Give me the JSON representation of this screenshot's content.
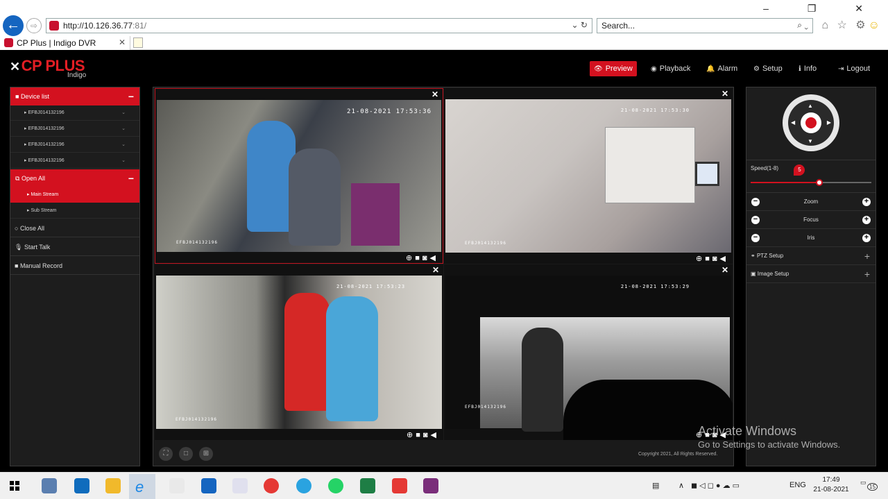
{
  "browser": {
    "url_host": "http://10.126.36.77",
    "url_port": ":81/",
    "url_ctrls": "⌄ ↻",
    "search_placeholder": "Search...",
    "search_icon": "⌕ ⌄",
    "tab_title": "CP Plus | Indigo DVR",
    "tab_close": "✕",
    "window_controls": "– ❐ ✕",
    "toolbar_icons": "⌂ ☆ ⚙"
  },
  "app": {
    "logo": "CP PLUS",
    "logo_sub": "Indigo",
    "nav": [
      {
        "icon": "👁",
        "label": "Preview"
      },
      {
        "icon": "◉",
        "label": "Playback"
      },
      {
        "icon": "🔔",
        "label": "Alarm"
      },
      {
        "icon": "⚙",
        "label": "Setup"
      },
      {
        "icon": "ℹ",
        "label": "Info"
      },
      {
        "icon": "⇥",
        "label": "Logout"
      }
    ]
  },
  "left_panel": {
    "device_list_label": "Device list",
    "devices": [
      "EFBJ014132196",
      "EFBJ014132196",
      "EFBJ014132196",
      "EFBJ014132196"
    ],
    "open_all_label": "Open All",
    "main_stream": "Main Stream",
    "sub_stream": "Sub Stream",
    "close_all": "Close All",
    "start_talk": "Start Talk",
    "manual_record": "Manual Record"
  },
  "feeds": [
    {
      "timestamp": "21-08-2021 17:53:36",
      "label": "EFBJ014132196"
    },
    {
      "timestamp": "21-08-2021 17:53:30",
      "label": "EFBJ014132196"
    },
    {
      "timestamp": "21-08-2021 17:53:23",
      "label": "EFBJ014132196"
    },
    {
      "timestamp": "21-08-2021 17:53:29",
      "label": "EFBJ014132196"
    }
  ],
  "feed_controls": "⊕■◙◀",
  "footer": {
    "copyright": "Copyright 2021, All Rights Reserved."
  },
  "right_panel": {
    "speed_label": "Speed(1-8)",
    "speed_value": "5",
    "speed_level": 5,
    "zoom": "Zoom",
    "focus": "Focus",
    "iris": "Iris",
    "ptz_setup": "PTZ Setup",
    "image_setup": "Image Setup"
  },
  "watermark": {
    "title": "Activate Windows",
    "subtitle": "Go to Settings to activate Windows."
  },
  "taskbar": {
    "lang": "ENG",
    "time": "17:49",
    "date": "21-08-2021",
    "notifications": "15"
  },
  "colors": {
    "accent": "#d3111f",
    "background": "#000000",
    "panel": "#1d1d1d"
  }
}
